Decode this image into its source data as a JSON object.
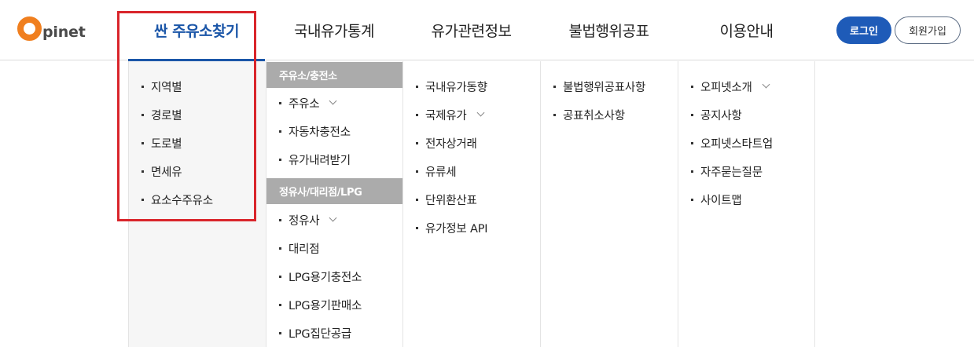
{
  "brand": {
    "logo_letter": "O",
    "logo_text": "pinet",
    "accent": "#f07f1f",
    "nav_active_color": "#1b56a8",
    "highlight_color": "#d9252b"
  },
  "nav": {
    "items": [
      {
        "label": "싼 주유소찾기",
        "active": true
      },
      {
        "label": "국내유가통계",
        "active": false
      },
      {
        "label": "유가관련정보",
        "active": false
      },
      {
        "label": "불법행위공표",
        "active": false
      },
      {
        "label": "이용안내",
        "active": false
      }
    ]
  },
  "auth": {
    "login_label": "로그인",
    "join_label": "회원가입"
  },
  "menu": {
    "col1": {
      "items": [
        "지역별",
        "경로별",
        "도로별",
        "면세유",
        "요소수주유소"
      ]
    },
    "col2": {
      "section1": {
        "title": "주유소/충전소",
        "items": [
          "주유소",
          "자동차충전소",
          "유가내려받기"
        ]
      },
      "section2": {
        "title": "정유사/대리점/LPG",
        "items": [
          "정유사",
          "대리점",
          "LPG용기충전소",
          "LPG용기판매소",
          "LPG집단공급"
        ]
      }
    },
    "col3": {
      "items": [
        "국내유가동향",
        "국제유가",
        "전자상거래",
        "유류세",
        "단위환산표",
        "유가정보 API"
      ]
    },
    "col4": {
      "items": [
        "불법행위공표사항",
        "공표취소사항"
      ]
    },
    "col5": {
      "items": [
        "오피넷소개",
        "공지사항",
        "오피넷스타트업",
        "자주묻는질문",
        "사이트맵"
      ]
    }
  },
  "icons": {
    "expand": "chevron-down-icon",
    "bullet": "bullet-dot"
  }
}
